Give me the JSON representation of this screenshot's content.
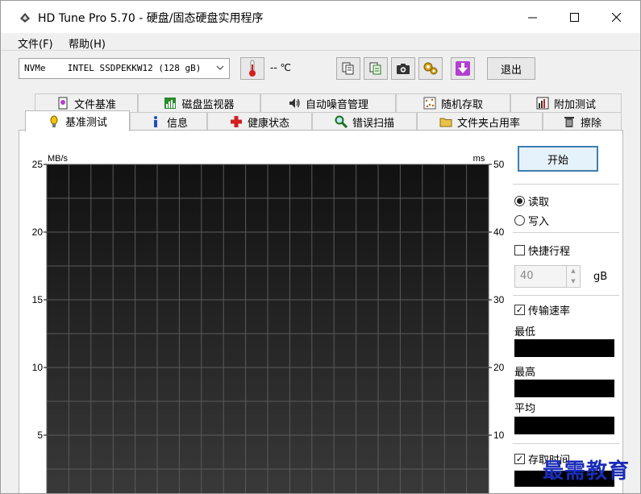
{
  "window": {
    "title": "HD Tune Pro 5.70 - 硬盘/固态硬盘实用程序"
  },
  "menu": {
    "items": [
      "文件(F)",
      "帮助(H)"
    ]
  },
  "toolbar": {
    "drive_type": "NVMe",
    "drive_name": "INTEL SSDPEKKW12 (128 gB)",
    "temperature": "-- ℃",
    "exit_label": "退出"
  },
  "tabs": {
    "top": [
      {
        "label": "文件基准",
        "icon": "file-benchmark-icon"
      },
      {
        "label": "磁盘监视器",
        "icon": "disk-monitor-icon"
      },
      {
        "label": "自动噪音管理",
        "icon": "speaker-icon"
      },
      {
        "label": "随机存取",
        "icon": "random-access-icon"
      },
      {
        "label": "附加测试",
        "icon": "extra-tests-icon"
      }
    ],
    "bottom": [
      {
        "label": "基准测试",
        "icon": "benchmark-icon",
        "active": true
      },
      {
        "label": "信息",
        "icon": "info-icon"
      },
      {
        "label": "健康状态",
        "icon": "health-cross-icon"
      },
      {
        "label": "错误扫描",
        "icon": "magnifier-icon"
      },
      {
        "label": "文件夹占用率",
        "icon": "folder-icon"
      },
      {
        "label": "擦除",
        "icon": "trash-icon"
      }
    ]
  },
  "chart_data": {
    "type": "line",
    "left_unit": "MB/s",
    "right_unit": "ms",
    "left_ylim": [
      0,
      25
    ],
    "right_ylim": [
      0,
      50
    ],
    "left_ticks": [
      25,
      20,
      15,
      10,
      5
    ],
    "right_ticks": [
      50,
      40,
      30,
      20,
      10
    ],
    "grid": true,
    "series": []
  },
  "controls": {
    "start_label": "开始",
    "read_label": "读取",
    "write_label": "写入",
    "mode_selected": "read",
    "short_stroke_label": "快捷行程",
    "short_stroke_checked": false,
    "short_stroke_value": "40",
    "short_stroke_unit": "gB",
    "transfer_rate_label": "传输速率",
    "transfer_rate_checked": true,
    "min_label": "最低",
    "max_label": "最高",
    "avg_label": "平均",
    "access_time_label": "存取时间",
    "access_time_checked": true
  },
  "watermark": "最需教育",
  "colors": {
    "chart_bg_top": "#111111",
    "chart_bg_bottom": "#3a3a3a",
    "grid": "#5a5a5a",
    "accent_border": "#3c7fb1",
    "watermark": "#1a2db8"
  }
}
